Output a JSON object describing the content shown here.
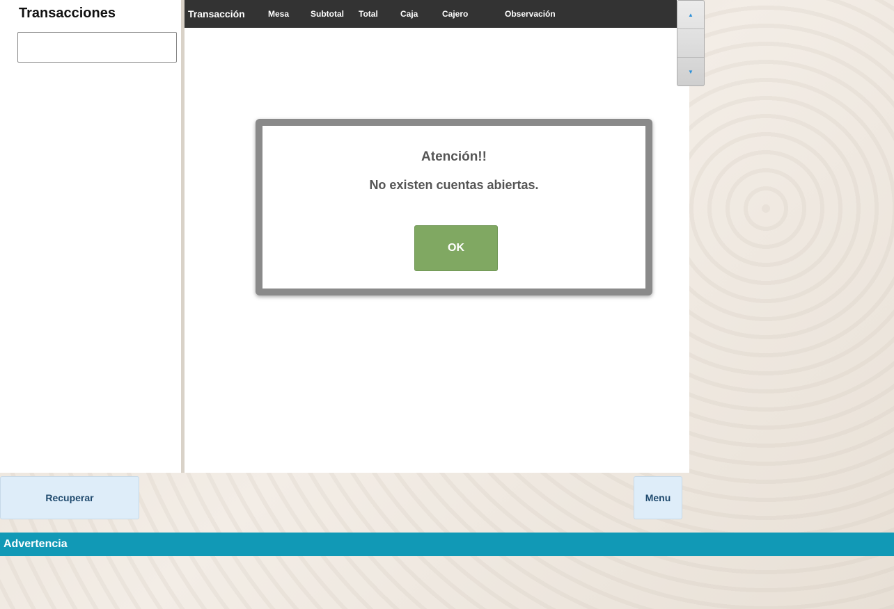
{
  "left_panel": {
    "title": "Transacciones",
    "search_value": ""
  },
  "table": {
    "columns": [
      "Transacción",
      "Mesa",
      "Subtotal",
      "Total",
      "Caja",
      "Cajero",
      "Observación"
    ],
    "rows": []
  },
  "scroller": {
    "up_icon": "▲",
    "down_icon": "▼"
  },
  "dialog": {
    "title": "Atención!!",
    "message": "No existen cuentas abiertas.",
    "ok_label": "OK"
  },
  "footer": {
    "recuperar_label": "Recuperar",
    "menu_label": "Menu"
  },
  "warning": {
    "label": "Advertencia"
  },
  "colors": {
    "header_bg": "#333333",
    "ok_button": "#80a862",
    "warning_bar": "#1199b6",
    "light_button": "#deedf9"
  }
}
